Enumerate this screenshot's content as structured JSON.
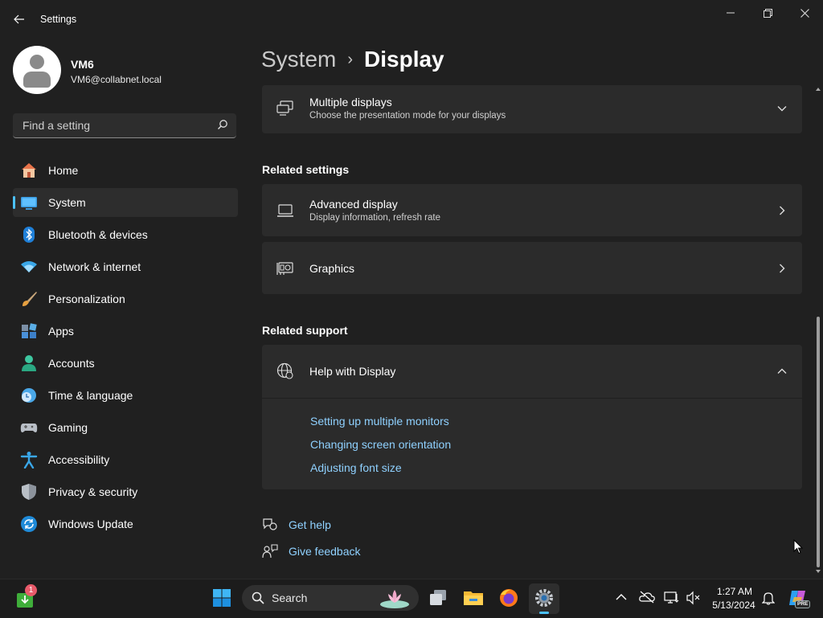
{
  "window": {
    "title": "Settings",
    "back_icon": "arrow-left-icon",
    "controls": [
      "minimize-icon",
      "restore-icon",
      "close-icon"
    ]
  },
  "profile": {
    "name": "VM6",
    "email": "VM6@collabnet.local"
  },
  "search": {
    "placeholder": "Find a setting",
    "value": ""
  },
  "sidebar": {
    "items": [
      {
        "label": "Home",
        "icon": "home-icon"
      },
      {
        "label": "System",
        "icon": "system-icon",
        "selected": true
      },
      {
        "label": "Bluetooth & devices",
        "icon": "bluetooth-icon"
      },
      {
        "label": "Network & internet",
        "icon": "wifi-icon"
      },
      {
        "label": "Personalization",
        "icon": "brush-icon"
      },
      {
        "label": "Apps",
        "icon": "apps-icon"
      },
      {
        "label": "Accounts",
        "icon": "accounts-icon"
      },
      {
        "label": "Time & language",
        "icon": "time-language-icon"
      },
      {
        "label": "Gaming",
        "icon": "gamepad-icon"
      },
      {
        "label": "Accessibility",
        "icon": "accessibility-icon"
      },
      {
        "label": "Privacy & security",
        "icon": "shield-icon"
      },
      {
        "label": "Windows Update",
        "icon": "update-icon"
      }
    ]
  },
  "breadcrumb": {
    "parent": "System",
    "separator": "›",
    "current": "Display"
  },
  "multiple_displays": {
    "title": "Multiple displays",
    "subtitle": "Choose the presentation mode for your displays"
  },
  "related_settings": {
    "heading": "Related settings",
    "advanced": {
      "title": "Advanced display",
      "subtitle": "Display information, refresh rate"
    },
    "graphics": {
      "title": "Graphics"
    }
  },
  "related_support": {
    "heading": "Related support",
    "help": {
      "title": "Help with Display",
      "links": [
        "Setting up multiple monitors",
        "Changing screen orientation",
        "Adjusting font size"
      ]
    }
  },
  "footer_links": {
    "get_help": "Get help",
    "give_feedback": "Give feedback"
  },
  "taskbar": {
    "search_label": "Search",
    "store_badge": "1",
    "time": "1:27 AM",
    "date": "5/13/2024",
    "copilot_badge": "PRE"
  },
  "colors": {
    "accent": "#4cc2ff",
    "link": "#8fd1ff",
    "background": "#202020",
    "card": "#2b2b2b"
  }
}
